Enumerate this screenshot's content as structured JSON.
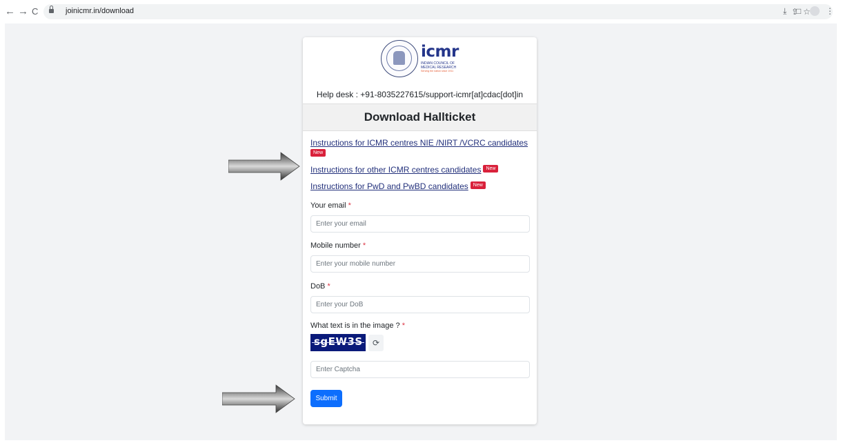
{
  "browser": {
    "back_icon": "←",
    "forward_icon": "→",
    "reload_icon": "C",
    "url": "joinicmr.in/download",
    "share_icon": "⇪",
    "star_icon": "☆",
    "download_icon": "⤓",
    "panel_icon": "□",
    "menu_icon": "⋮"
  },
  "logo": {
    "word": "icmr",
    "subtitle_line1": "INDIAN COUNCIL OF",
    "subtitle_line2": "MEDICAL RESEARCH",
    "tagline": "Serving the nation since 1911"
  },
  "helpdesk": "Help desk : +91-8035227615/support-icmr[at]cdac[dot]in",
  "title": "Download Hallticket",
  "instructions": [
    {
      "text": "Instructions for ICMR centres NIE /NIRT /VCRC candidates",
      "badge": "New"
    },
    {
      "text": "Instructions for other ICMR centres candidates",
      "badge": "New"
    },
    {
      "text": "Instructions for PwD and PwBD candidates",
      "badge": "New"
    }
  ],
  "form": {
    "email": {
      "label": "Your email",
      "required": "*",
      "placeholder": "Enter your email"
    },
    "mobile": {
      "label": "Mobile number",
      "required": "*",
      "placeholder": "Enter your mobile number"
    },
    "dob": {
      "label": "DoB",
      "required": "*",
      "placeholder": "Enter your DoB"
    },
    "captcha": {
      "label": "What text is in the image ?",
      "required": "*",
      "image_text": "sgEW3S",
      "placeholder": "Enter Captcha",
      "refresh_icon": "⟳"
    },
    "submit_label": "Submit"
  },
  "colors": {
    "link": "#22307b",
    "badge": "#d9213b",
    "submit": "#0d6efd",
    "captcha_bg": "#0a1a7a",
    "required": "#dc3545"
  }
}
